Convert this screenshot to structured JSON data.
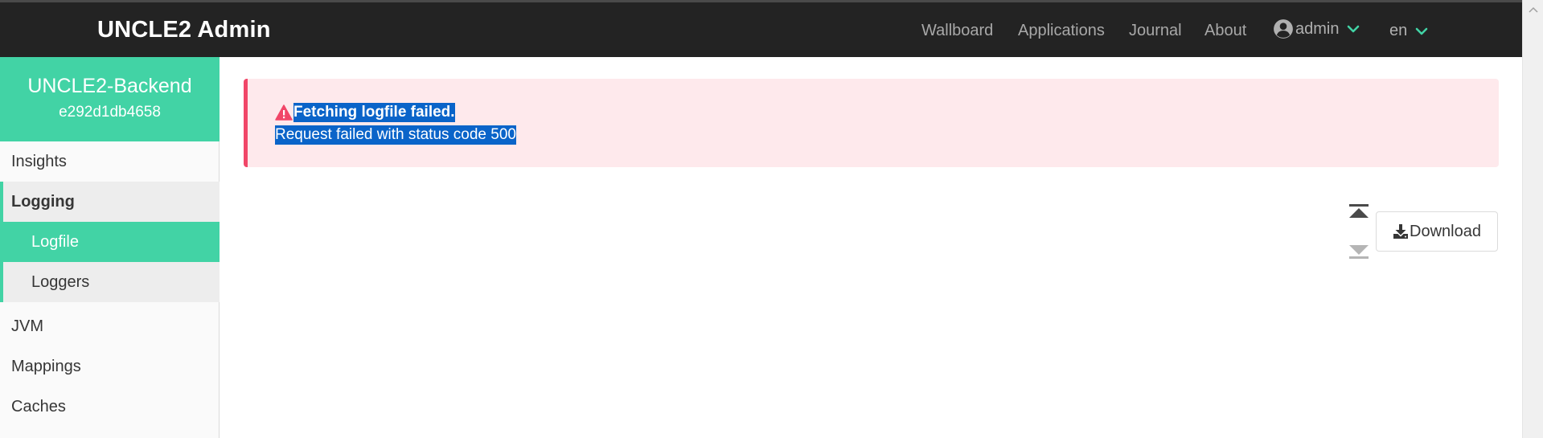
{
  "navbar": {
    "brand": "UNCLE2 Admin",
    "links": [
      "Wallboard",
      "Applications",
      "Journal",
      "About"
    ],
    "user": "admin",
    "language": "en"
  },
  "sidebar": {
    "instance_name": "UNCLE2-Backend",
    "instance_id": "e292d1db4658",
    "items": {
      "insights": "Insights",
      "logging": "Logging",
      "logfile": "Logfile",
      "loggers": "Loggers",
      "jvm": "JVM",
      "mappings": "Mappings",
      "caches": "Caches"
    }
  },
  "alert": {
    "title": "Fetching logfile failed.",
    "message": "Request failed with status code 500"
  },
  "actions": {
    "download_label": "Download"
  },
  "colors": {
    "accent": "#42d3a5",
    "navbar": "#232323",
    "danger": "#f14668",
    "danger_bg": "#fee9ec"
  }
}
